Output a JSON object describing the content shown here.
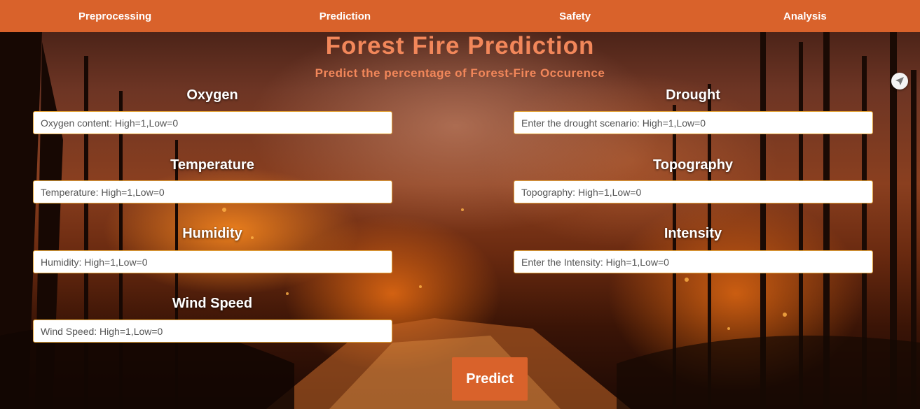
{
  "nav": {
    "items": [
      {
        "label": "Preprocessing"
      },
      {
        "label": "Prediction"
      },
      {
        "label": "Safety"
      },
      {
        "label": "Analysis"
      }
    ]
  },
  "header": {
    "title": "Forest Fire Prediction",
    "subtitle": "Predict the percentage of Forest-Fire Occurence"
  },
  "form": {
    "oxygen": {
      "label": "Oxygen",
      "placeholder": "Oxygen content: High=1,Low=0",
      "value": ""
    },
    "temperature": {
      "label": "Temperature",
      "placeholder": "Temperature: High=1,Low=0",
      "value": ""
    },
    "humidity": {
      "label": "Humidity",
      "placeholder": "Humidity: High=1,Low=0",
      "value": ""
    },
    "wind_speed": {
      "label": "Wind Speed",
      "placeholder": "Wind Speed: High=1,Low=0",
      "value": ""
    },
    "drought": {
      "label": "Drought",
      "placeholder": "Enter the drought scenario: High=1,Low=0",
      "value": ""
    },
    "topography": {
      "label": "Topography",
      "placeholder": "Topography: High=1,Low=0",
      "value": ""
    },
    "intensity": {
      "label": "Intensity",
      "placeholder": "Enter the Intensity: High=1,Low=0",
      "value": ""
    },
    "predict_label": "Predict"
  },
  "widget": {
    "icon": "send-icon"
  },
  "colors": {
    "nav_bg": "#d9622b",
    "title": "#f2875a",
    "button_bg": "#d9622b",
    "input_border": "#e4a53a"
  }
}
